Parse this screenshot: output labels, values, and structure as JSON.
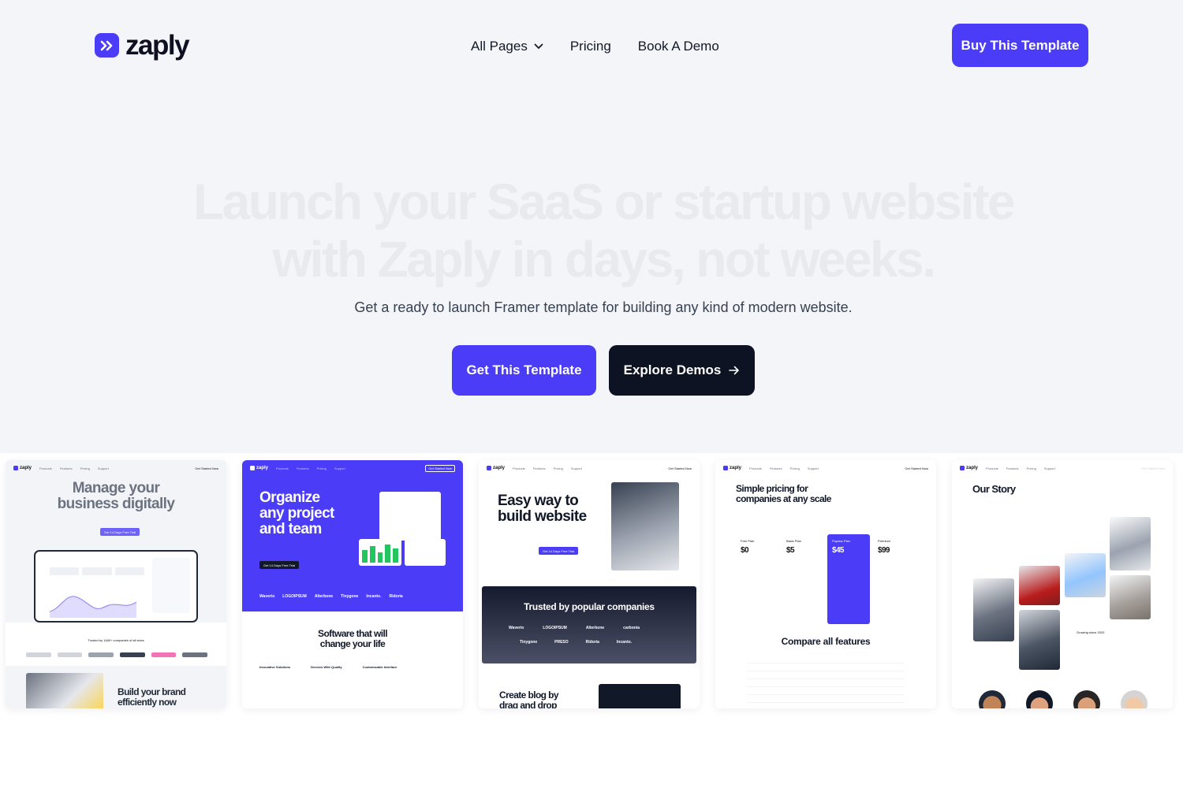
{
  "brand": {
    "name": "zaply",
    "logo_glyph": "»",
    "accent": "#4b3cf7"
  },
  "nav": {
    "items": [
      {
        "label": "All Pages"
      },
      {
        "label": "Pricing"
      },
      {
        "label": "Book A Demo"
      }
    ]
  },
  "header": {
    "cta_label": "Buy This Template"
  },
  "hero": {
    "headline_line1": "Launch your SaaS or startup website",
    "headline_line2": "with Zaply in days, not weeks.",
    "subtitle": "Get a ready to launch Framer template for building any kind of modern website.",
    "primary_label": "Get This Template",
    "secondary_label": "Explore Demos"
  },
  "cards": {
    "c1": {
      "title_l1": "Manage your",
      "title_l2": "business digitally",
      "trusted": "Trusted by 1480+ companies of all sizes",
      "build_l1": "Build your brand",
      "build_l2": "efficiently now",
      "cta": "Get 14 Days Free Trial"
    },
    "c2": {
      "title_l1": "Organize",
      "title_l2": "any project",
      "title_l3": "and team",
      "cta": "Get 14 Days Free Trial",
      "logos": [
        "Waverio",
        "LOGOIPSUM",
        "Alterbone",
        "Tinygone",
        "Incanto.",
        "Ridoria"
      ],
      "sw_l1": "Software that will",
      "sw_l2": "change your life",
      "features": [
        "Innovative Solutions",
        "Devices With Quality",
        "Customizable Interface"
      ]
    },
    "c3": {
      "title_l1": "Easy way to",
      "title_l2": "build website",
      "cta": "Get 14 Days Free Trial",
      "trusted": "Trusted by popular companies",
      "logos_row1": [
        "Waverio",
        "LOGOIPSUM",
        "Alterbone",
        "carbonia"
      ],
      "logos_row2": [
        "Tinygone",
        "PRESO",
        "Ridoria",
        "Incanto."
      ],
      "blog_l1": "Create blog by",
      "blog_l2": "drag and drop"
    },
    "c4": {
      "title_l1": "Simple pricing for",
      "title_l2": "companies at any scale",
      "plans": [
        {
          "name": "Free Plan",
          "price": "$0"
        },
        {
          "name": "Basic Plan",
          "price": "$5"
        },
        {
          "name": "Popular Plan",
          "price": "$45"
        },
        {
          "name": "Premium",
          "price": "$99"
        }
      ],
      "compare": "Compare all features"
    },
    "c5": {
      "title": "Our Story",
      "growing": "Growing since 2020"
    }
  },
  "nav_items_mini": [
    "Products",
    "Features",
    "Pricing",
    "Support"
  ],
  "mini_start": "Get Started Now"
}
